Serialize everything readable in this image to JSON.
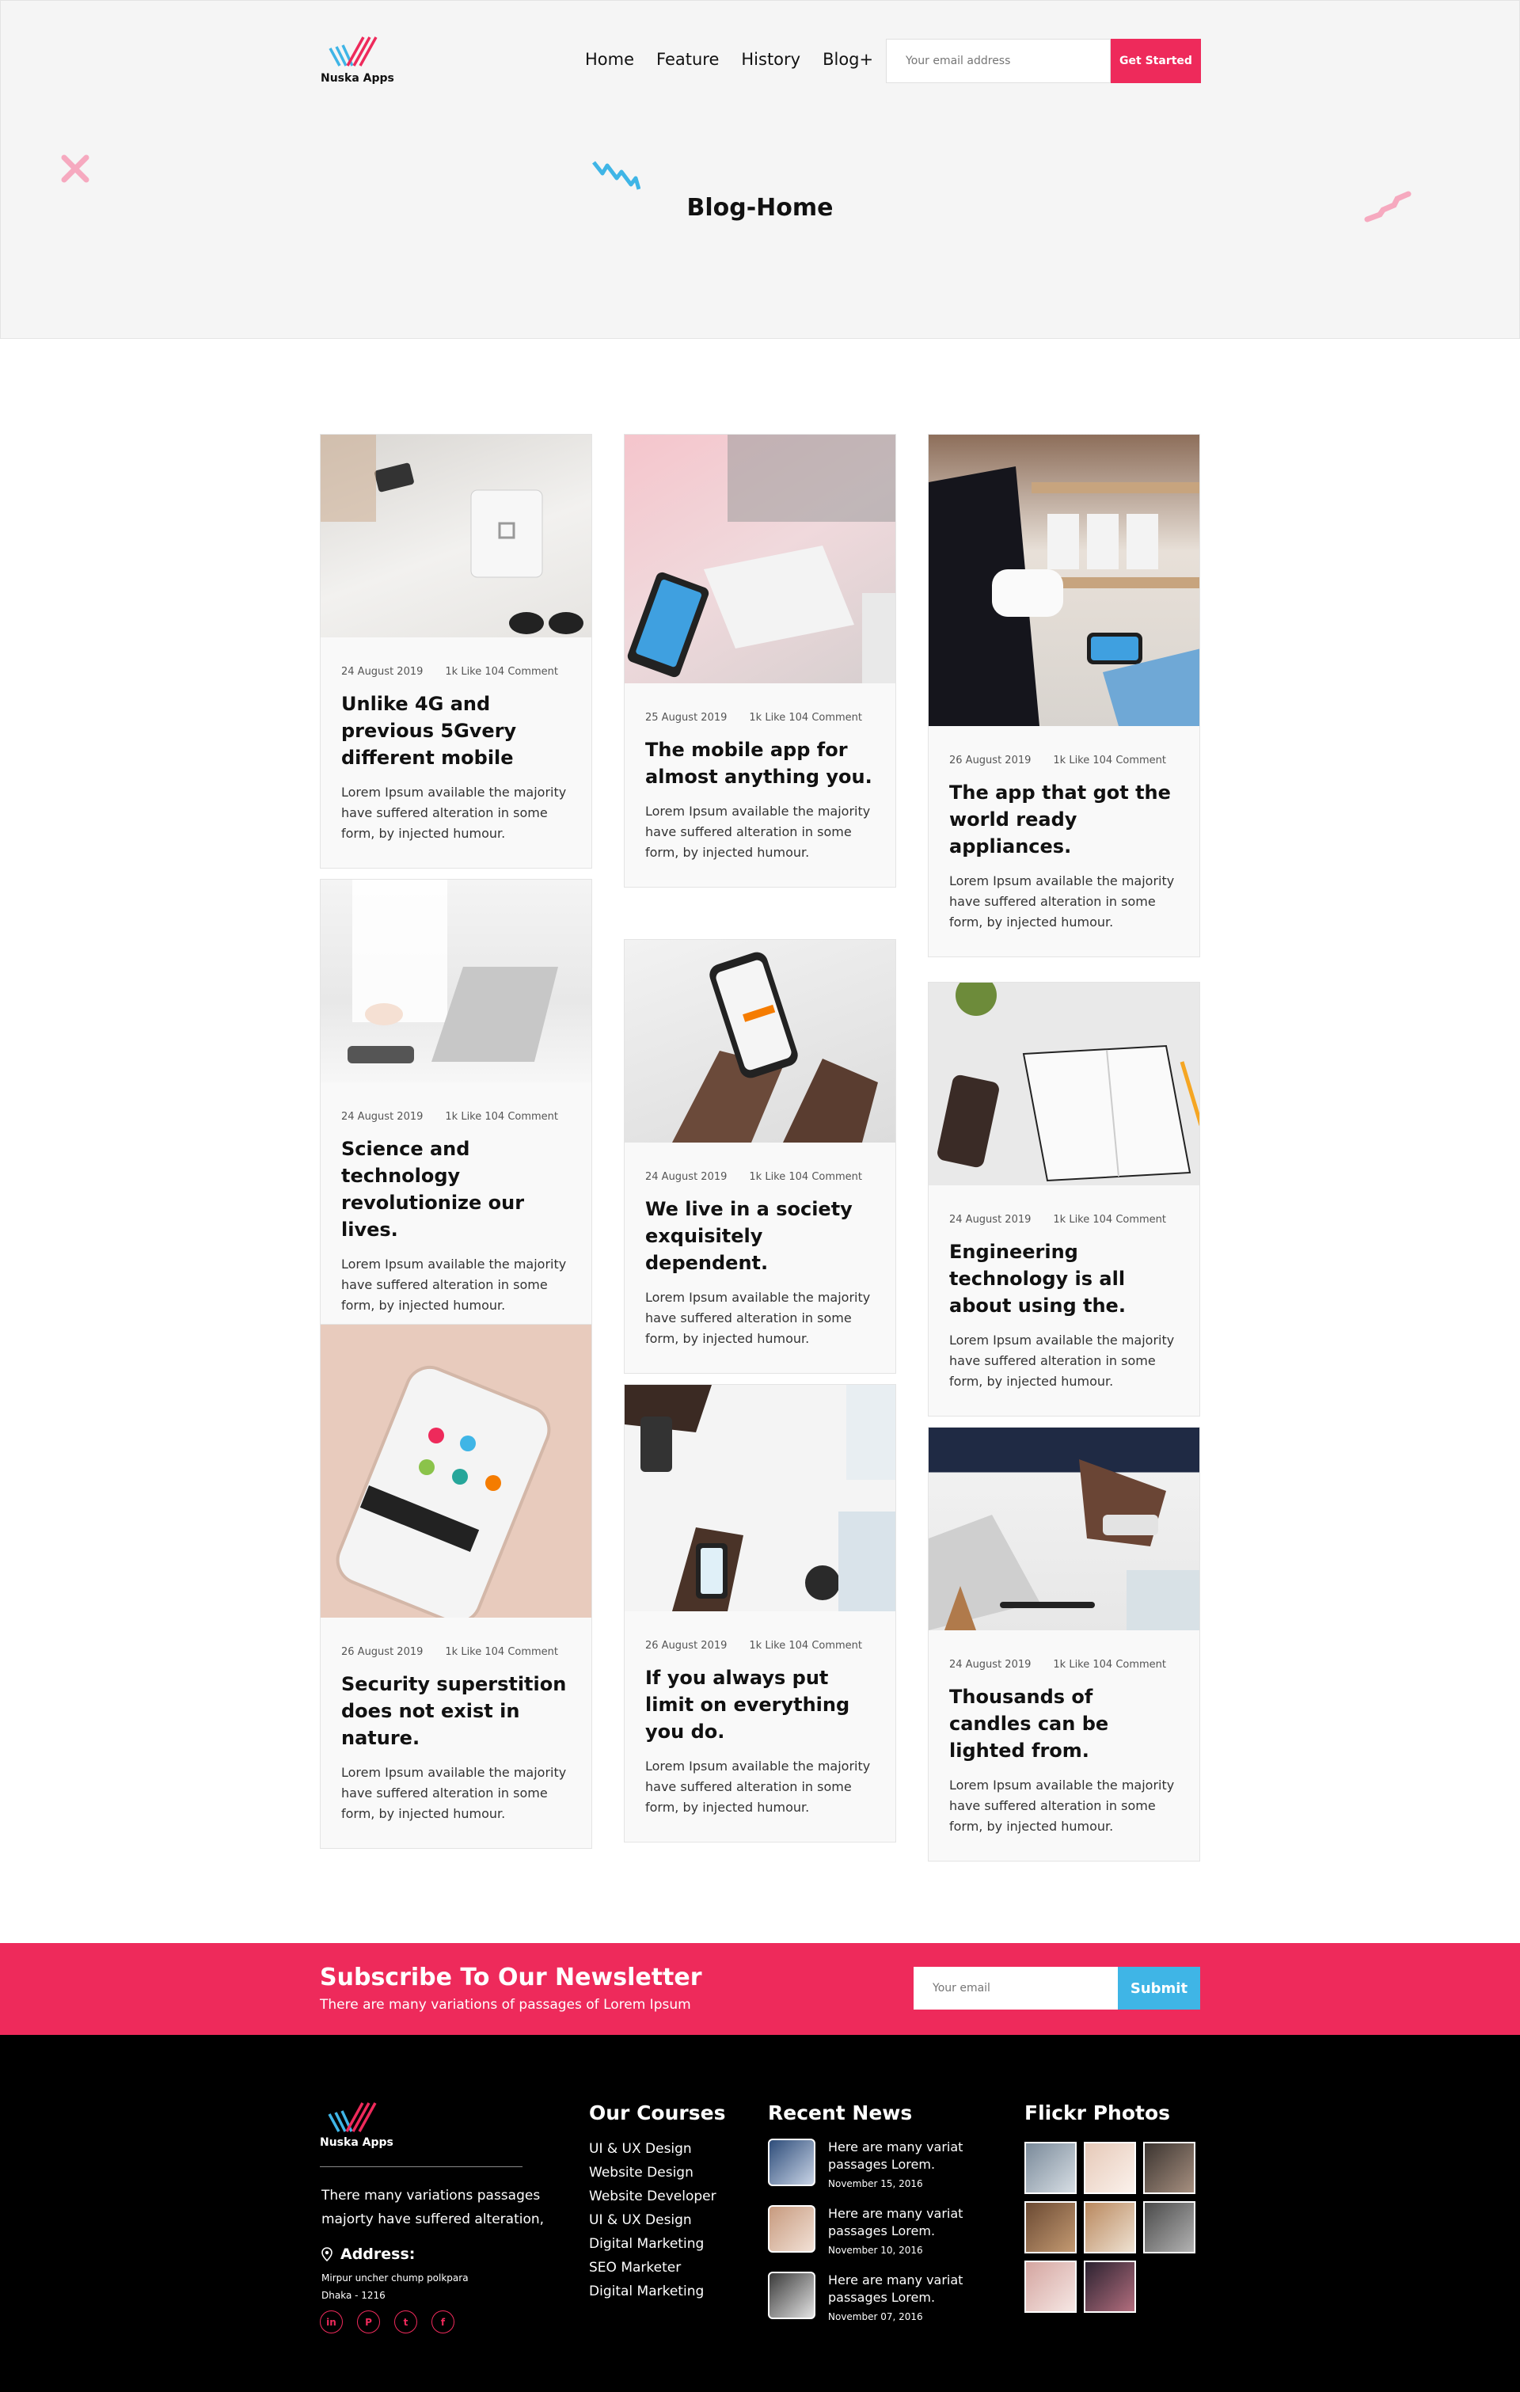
{
  "brand": {
    "name": "Nuska Apps"
  },
  "nav": [
    "Home",
    "Feature",
    "History",
    "Blog+"
  ],
  "header_subscribe": {
    "placeholder": "Your email address",
    "button": "Get Started"
  },
  "hero": {
    "title": "Blog-Home"
  },
  "posts": [
    {
      "date": "24 August 2019",
      "stats": "1k Like 104 Comment",
      "title": "Unlike 4G and previous 5Gvery different mobile",
      "excerpt": "Lorem Ipsum available the majority have suffered alteration in some form, by injected humour."
    },
    {
      "date": "25 August 2019",
      "stats": "1k Like 104 Comment",
      "title": "The mobile app for almost anything you.",
      "excerpt": "Lorem Ipsum available the majority have suffered alteration in some form, by injected humour."
    },
    {
      "date": "26 August 2019",
      "stats": "1k Like 104 Comment",
      "title": "The app that got the world ready appliances.",
      "excerpt": "Lorem Ipsum available the majority have suffered alteration in some form, by injected humour."
    },
    {
      "date": "24 August 2019",
      "stats": "1k Like 104 Comment",
      "title": "Science and technology revolutionize our lives.",
      "excerpt": "Lorem Ipsum available the majority have suffered alteration in some form, by injected humour."
    },
    {
      "date": "24 August 2019",
      "stats": "1k Like 104 Comment",
      "title": "We live in a society exquisitely dependent.",
      "excerpt": "Lorem Ipsum available the majority have suffered alteration in some form, by injected humour."
    },
    {
      "date": "24 August 2019",
      "stats": "1k Like 104 Comment",
      "title": "Engineering technology is all about using the.",
      "excerpt": "Lorem Ipsum available the majority have suffered alteration in some form, by injected humour."
    },
    {
      "date": "26 August 2019",
      "stats": "1k Like 104 Comment",
      "title": "Security superstition does not exist in nature.",
      "excerpt": "Lorem Ipsum available the majority have suffered alteration in some form, by injected humour."
    },
    {
      "date": "26 August 2019",
      "stats": "1k Like 104 Comment",
      "title": "If you always put limit on everything you do.",
      "excerpt": "Lorem Ipsum available the majority have suffered alteration in some form, by injected humour."
    },
    {
      "date": "24 August 2019",
      "stats": "1k Like 104 Comment",
      "title": "Thousands of candles can be lighted from.",
      "excerpt": "Lorem Ipsum available the majority have suffered alteration in some form, by injected humour."
    }
  ],
  "newsletter": {
    "title": "Subscribe To Our Newsletter",
    "subtitle": "There are many variations of passages of Lorem Ipsum",
    "placeholder": "Your email",
    "button": "Submit"
  },
  "footer": {
    "about": "There many variations passages majorty have suffered alteration,",
    "address_label": "Address:",
    "address_line1": "Mirpur uncher chump polkpara",
    "address_line2": "Dhaka - 1216",
    "social": [
      "in",
      "P",
      "t",
      "f"
    ],
    "courses_title": "Our Courses",
    "courses": [
      "UI & UX Design",
      "Website Design",
      "Website Developer",
      "UI & UX Design",
      "Digital Marketing",
      "SEO Marketer",
      "Digital Marketing"
    ],
    "news_title": "Recent News",
    "news": [
      {
        "title": "Here are many variat passages Lorem.",
        "date": "November 15, 2016"
      },
      {
        "title": "Here are many variat passages Lorem.",
        "date": "November 10, 2016"
      },
      {
        "title": "Here are many variat passages Lorem.",
        "date": "November 07, 2016"
      }
    ],
    "flickr_title": "Flickr Photos"
  },
  "colors": {
    "accent": "#ee2a5b",
    "secondary": "#3fb5e6",
    "footer_bg": "#000000"
  }
}
